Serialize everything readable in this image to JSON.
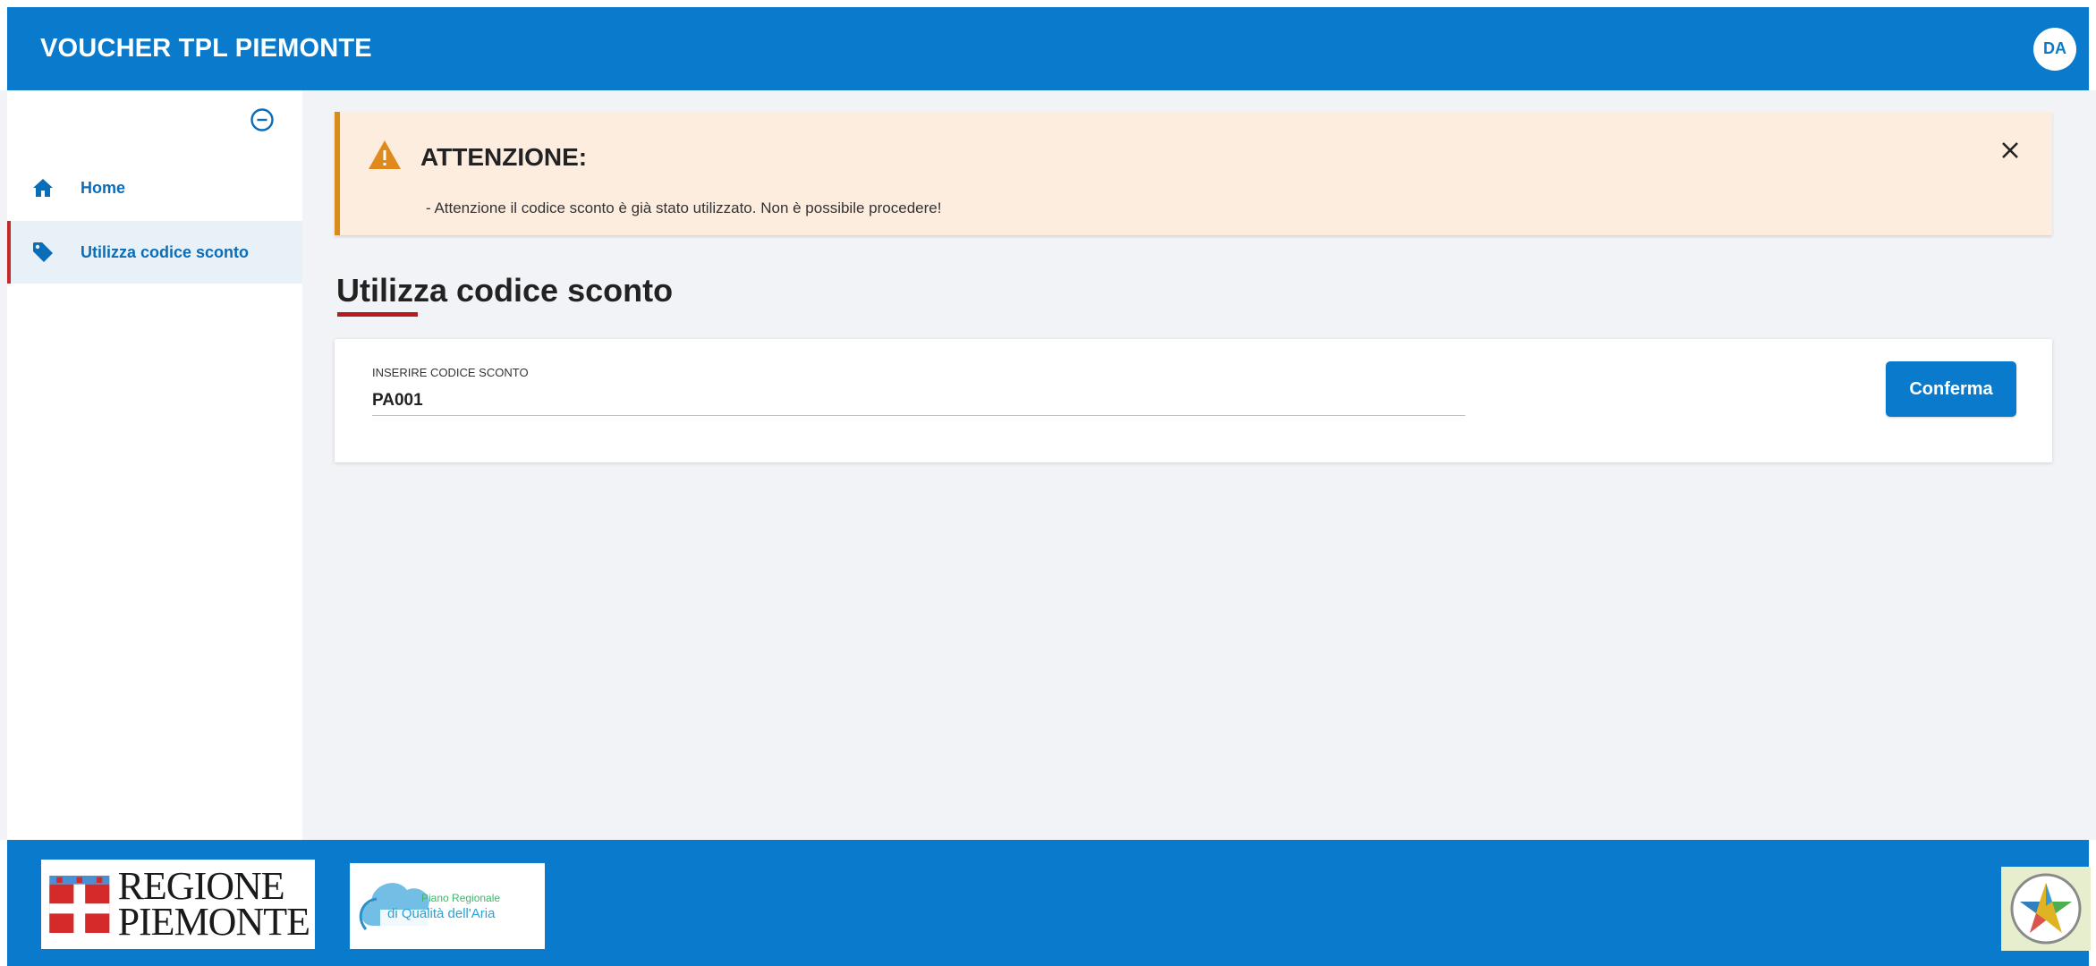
{
  "header": {
    "title": "VOUCHER TPL PIEMONTE",
    "avatar_initials": "DA"
  },
  "sidebar": {
    "collapse_icon": "minus-circle-icon",
    "items": [
      {
        "label": "Home",
        "icon": "home-icon",
        "active": false
      },
      {
        "label": "Utilizza codice sconto",
        "icon": "tag-icon",
        "active": true
      }
    ]
  },
  "alert": {
    "title": "ATTENZIONE:",
    "message": "- Attenzione il codice sconto è già stato utilizzato. Non è possibile procedere!",
    "icon": "warning-icon",
    "close_icon": "close-icon"
  },
  "main": {
    "page_title": "Utilizza codice sconto",
    "form": {
      "field_label": "INSERIRE CODICE SCONTO",
      "field_value": "PA001",
      "confirm_label": "Conferma"
    }
  },
  "footer": {
    "logo_regione_line1": "REGIONE",
    "logo_regione_line2": "PIEMONTE",
    "logo_aria_line1": "Piano Regionale",
    "logo_aria_line2": "di Qualità dell'Aria"
  },
  "colors": {
    "primary": "#0a7bcc",
    "accent_red": "#b71c1c",
    "warning_bg": "#fdeddf",
    "warning_border": "#d98c1c"
  }
}
